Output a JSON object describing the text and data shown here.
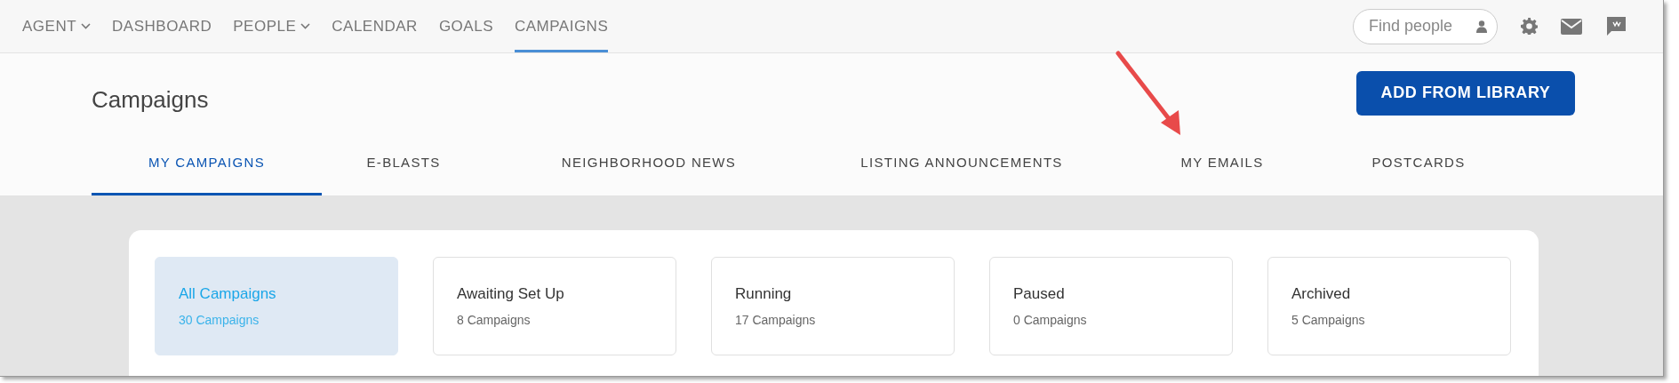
{
  "nav": {
    "items": [
      {
        "label": "AGENT",
        "dropdown": true,
        "selected": false
      },
      {
        "label": "DASHBOARD",
        "dropdown": false,
        "selected": false
      },
      {
        "label": "PEOPLE",
        "dropdown": true,
        "selected": false
      },
      {
        "label": "CALENDAR",
        "dropdown": false,
        "selected": false
      },
      {
        "label": "GOALS",
        "dropdown": false,
        "selected": false
      },
      {
        "label": "CAMPAIGNS",
        "dropdown": false,
        "selected": true
      }
    ],
    "search": {
      "placeholder": "Find people"
    }
  },
  "page": {
    "title": "Campaigns",
    "primary_button": "ADD FROM LIBRARY"
  },
  "tabs": [
    {
      "label": "MY CAMPAIGNS",
      "selected": true
    },
    {
      "label": "E-BLASTS",
      "selected": false
    },
    {
      "label": "NEIGHBORHOOD NEWS",
      "selected": false
    },
    {
      "label": "LISTING ANNOUNCEMENTS",
      "selected": false
    },
    {
      "label": "MY EMAILS",
      "selected": false
    },
    {
      "label": "POSTCARDS",
      "selected": false
    }
  ],
  "filters": [
    {
      "title": "All Campaigns",
      "count": "30 Campaigns",
      "selected": true
    },
    {
      "title": "Awaiting Set Up",
      "count": "8 Campaigns",
      "selected": false
    },
    {
      "title": "Running",
      "count": "17 Campaigns",
      "selected": false
    },
    {
      "title": "Paused",
      "count": "0 Campaigns",
      "selected": false
    },
    {
      "title": "Archived",
      "count": "5 Campaigns",
      "selected": false
    }
  ]
}
